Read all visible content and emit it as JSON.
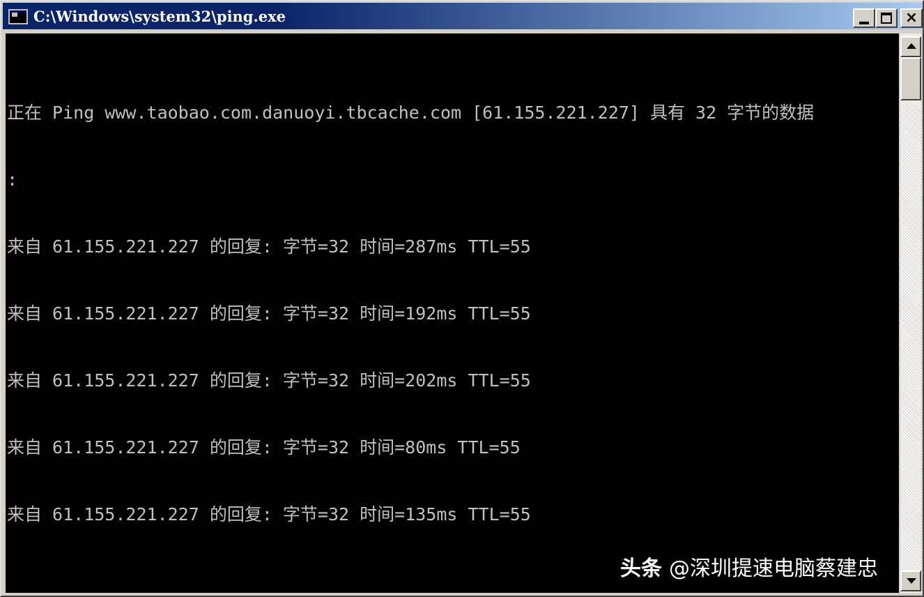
{
  "window": {
    "title": "C:\\Windows\\system32\\ping.exe",
    "buttons": {
      "minimize": "_",
      "maximize": "□",
      "close": "×"
    }
  },
  "console": {
    "lines": [
      "正在 Ping www.taobao.com.danuoyi.tbcache.com [61.155.221.227] 具有 32 字节的数据",
      ":",
      "来自 61.155.221.227 的回复: 字节=32 时间=287ms TTL=55",
      "来自 61.155.221.227 的回复: 字节=32 时间=192ms TTL=55",
      "来自 61.155.221.227 的回复: 字节=32 时间=202ms TTL=55",
      "来自 61.155.221.227 的回复: 字节=32 时间=80ms TTL=55",
      "来自 61.155.221.227 的回复: 字节=32 时间=135ms TTL=55"
    ]
  },
  "watermark": {
    "brand": "头条",
    "handle": "@深圳提速电脑蔡建忠"
  },
  "colors": {
    "titlebar_start": "#0a246a",
    "titlebar_end": "#a6caf0",
    "console_bg": "#000000",
    "console_text": "#c0c0c0",
    "chrome": "#d4d0c8"
  },
  "icons": {
    "system": "console-app-icon",
    "minimize": "minimize-icon",
    "maximize": "maximize-icon",
    "close": "close-icon",
    "scroll_up": "arrow-up-icon",
    "scroll_down": "arrow-down-icon"
  }
}
